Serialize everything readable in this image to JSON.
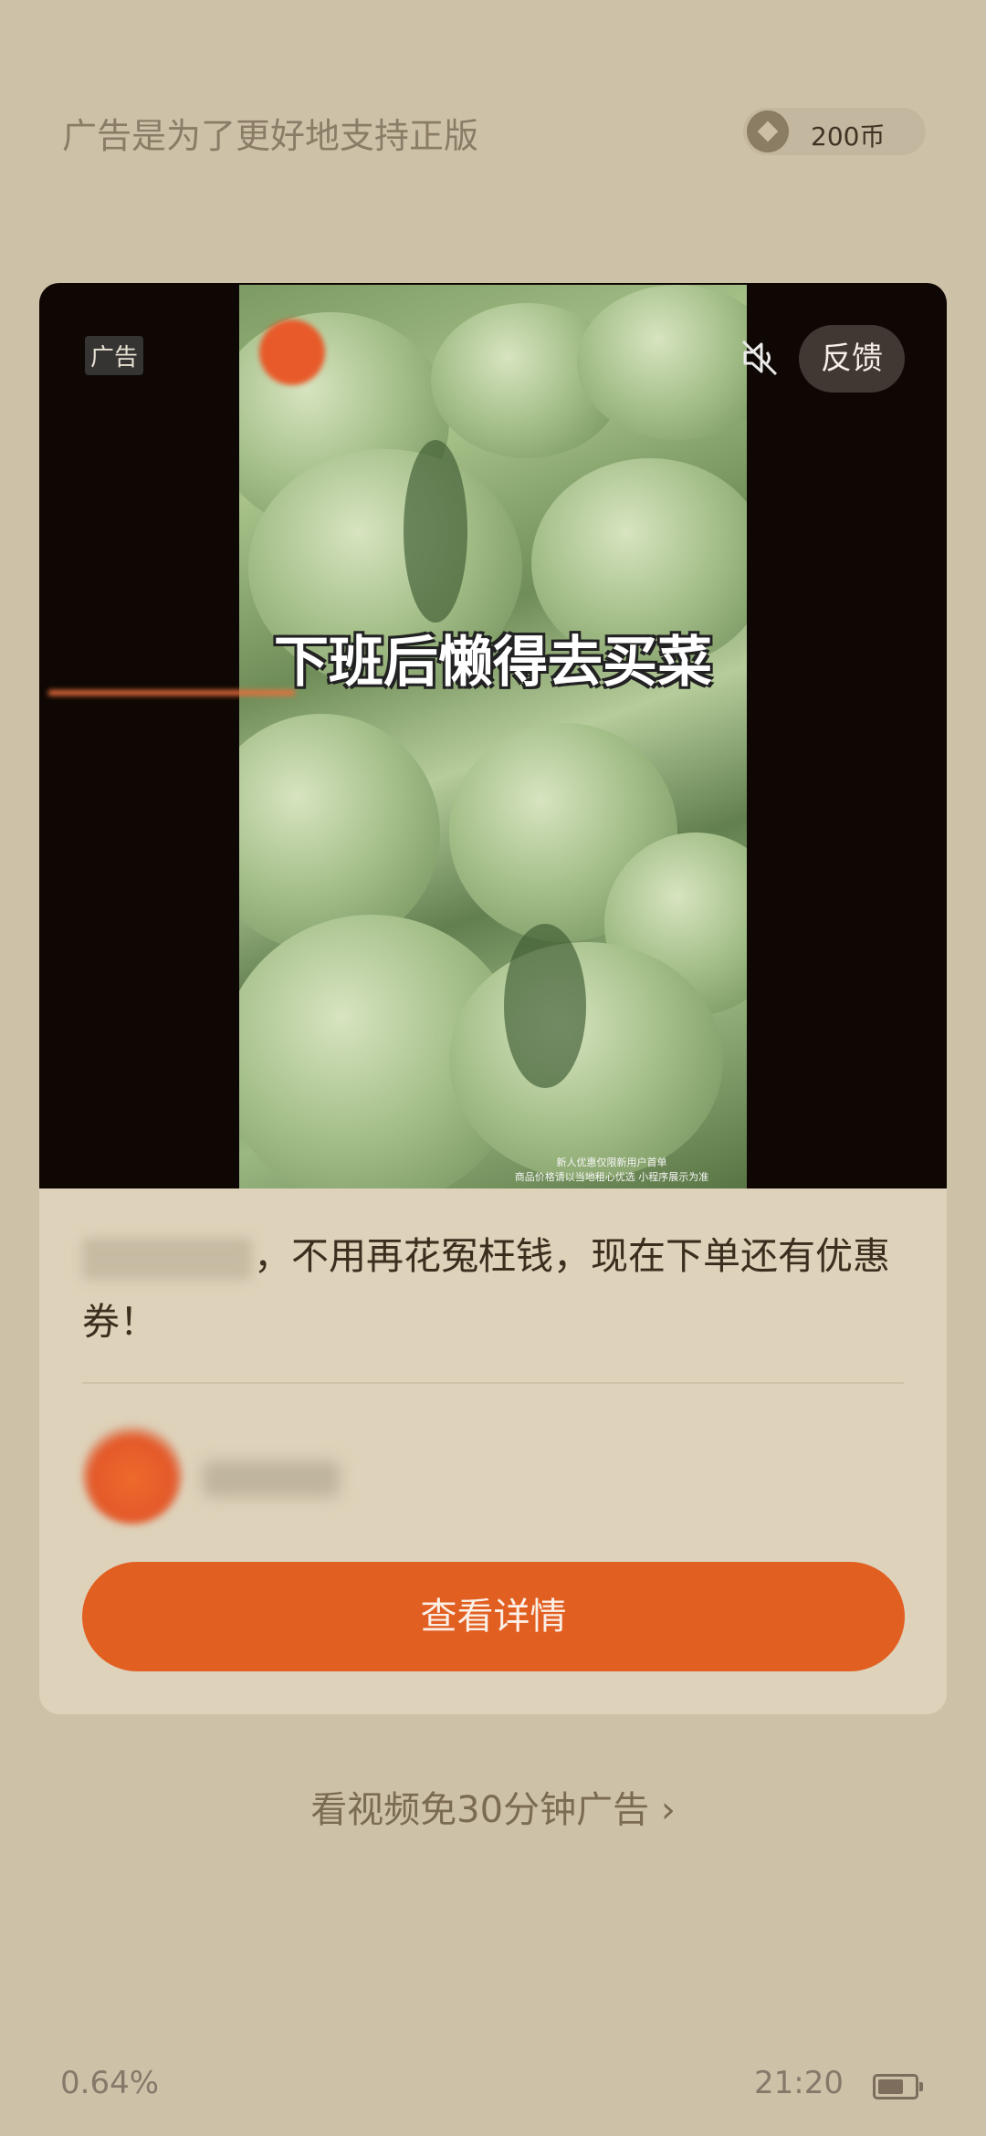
{
  "header": {
    "title": "广告是为了更好地支持正版",
    "coins_label": "200币"
  },
  "ad_card": {
    "ad_tag": "广告",
    "feedback_label": "反馈",
    "video": {
      "caption": "下班后懒得去买菜",
      "disclaimer_line1": "新人优惠仅限新用户首单",
      "disclaimer_line2": "商品价格请以当地租心优选 小程序展示为准"
    },
    "description_text": "，不用再花冤枉钱，现在下单还有优惠券！",
    "cta_label": "查看详情"
  },
  "skip_link": {
    "text": "看视频免30分钟广告",
    "chevron": "›"
  },
  "status": {
    "left_text": "0.64%",
    "time": "21:20",
    "battery_level": 0.7
  },
  "icons": {
    "coin": "coin-icon",
    "mute": "speaker-muted-icon",
    "chevron": "chevron-right-icon",
    "battery": "battery-icon"
  },
  "colors": {
    "accent": "#e25f22",
    "background": "#cdc2a8",
    "card": "#ded2ba"
  }
}
